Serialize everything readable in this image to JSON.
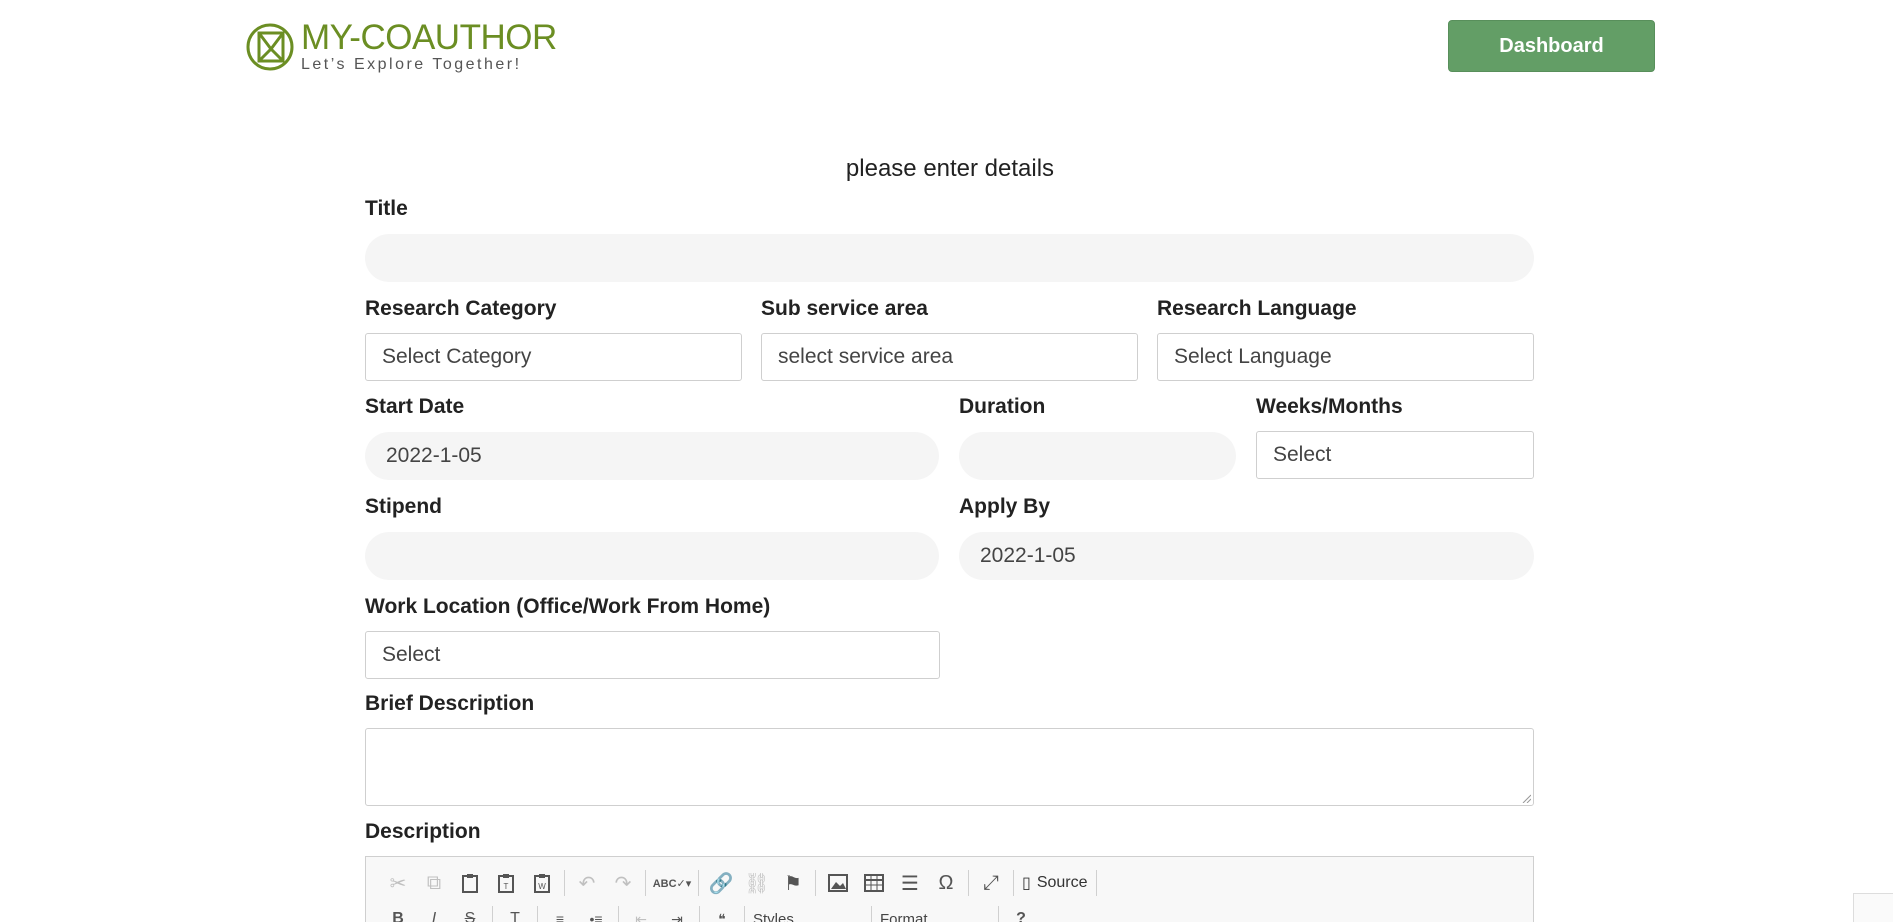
{
  "header": {
    "brand_name": "MY-COAUTHOR",
    "brand_tagline": "Let’s Explore Together!",
    "dashboard_label": "Dashboard"
  },
  "form": {
    "heading": "please enter details",
    "title_label": "Title",
    "title_value": "",
    "research_category_label": "Research Category",
    "research_category_value": "Select Category",
    "sub_service_area_label": "Sub service area",
    "sub_service_area_value": "select service area",
    "research_language_label": "Research Language",
    "research_language_value": "Select Language",
    "start_date_label": "Start Date",
    "start_date_value": "2022-1-05",
    "duration_label": "Duration",
    "duration_value": "",
    "weeks_months_label": "Weeks/Months",
    "weeks_months_value": "Select",
    "stipend_label": "Stipend",
    "stipend_value": "",
    "apply_by_label": "Apply By",
    "apply_by_value": "2022-1-05",
    "work_location_label": "Work Location (Office/Work From Home)",
    "work_location_value": "Select",
    "brief_description_label": "Brief Description",
    "description_label": "Description"
  },
  "editor": {
    "source_label": "Source",
    "styles_label": "Styles",
    "format_label": "Format",
    "toolbar_icons": [
      "cut-icon",
      "copy-icon",
      "paste-icon",
      "paste-text-icon",
      "paste-word-icon",
      "undo-icon",
      "redo-icon",
      "spellcheck-icon",
      "link-icon",
      "unlink-icon",
      "anchor-icon",
      "image-icon",
      "table-icon",
      "horizontal-line-icon",
      "special-char-icon",
      "maximize-icon",
      "source-icon"
    ]
  },
  "colors": {
    "brand": "#6b8e23",
    "button": "#639e66",
    "input_bg": "#f5f5f5"
  }
}
